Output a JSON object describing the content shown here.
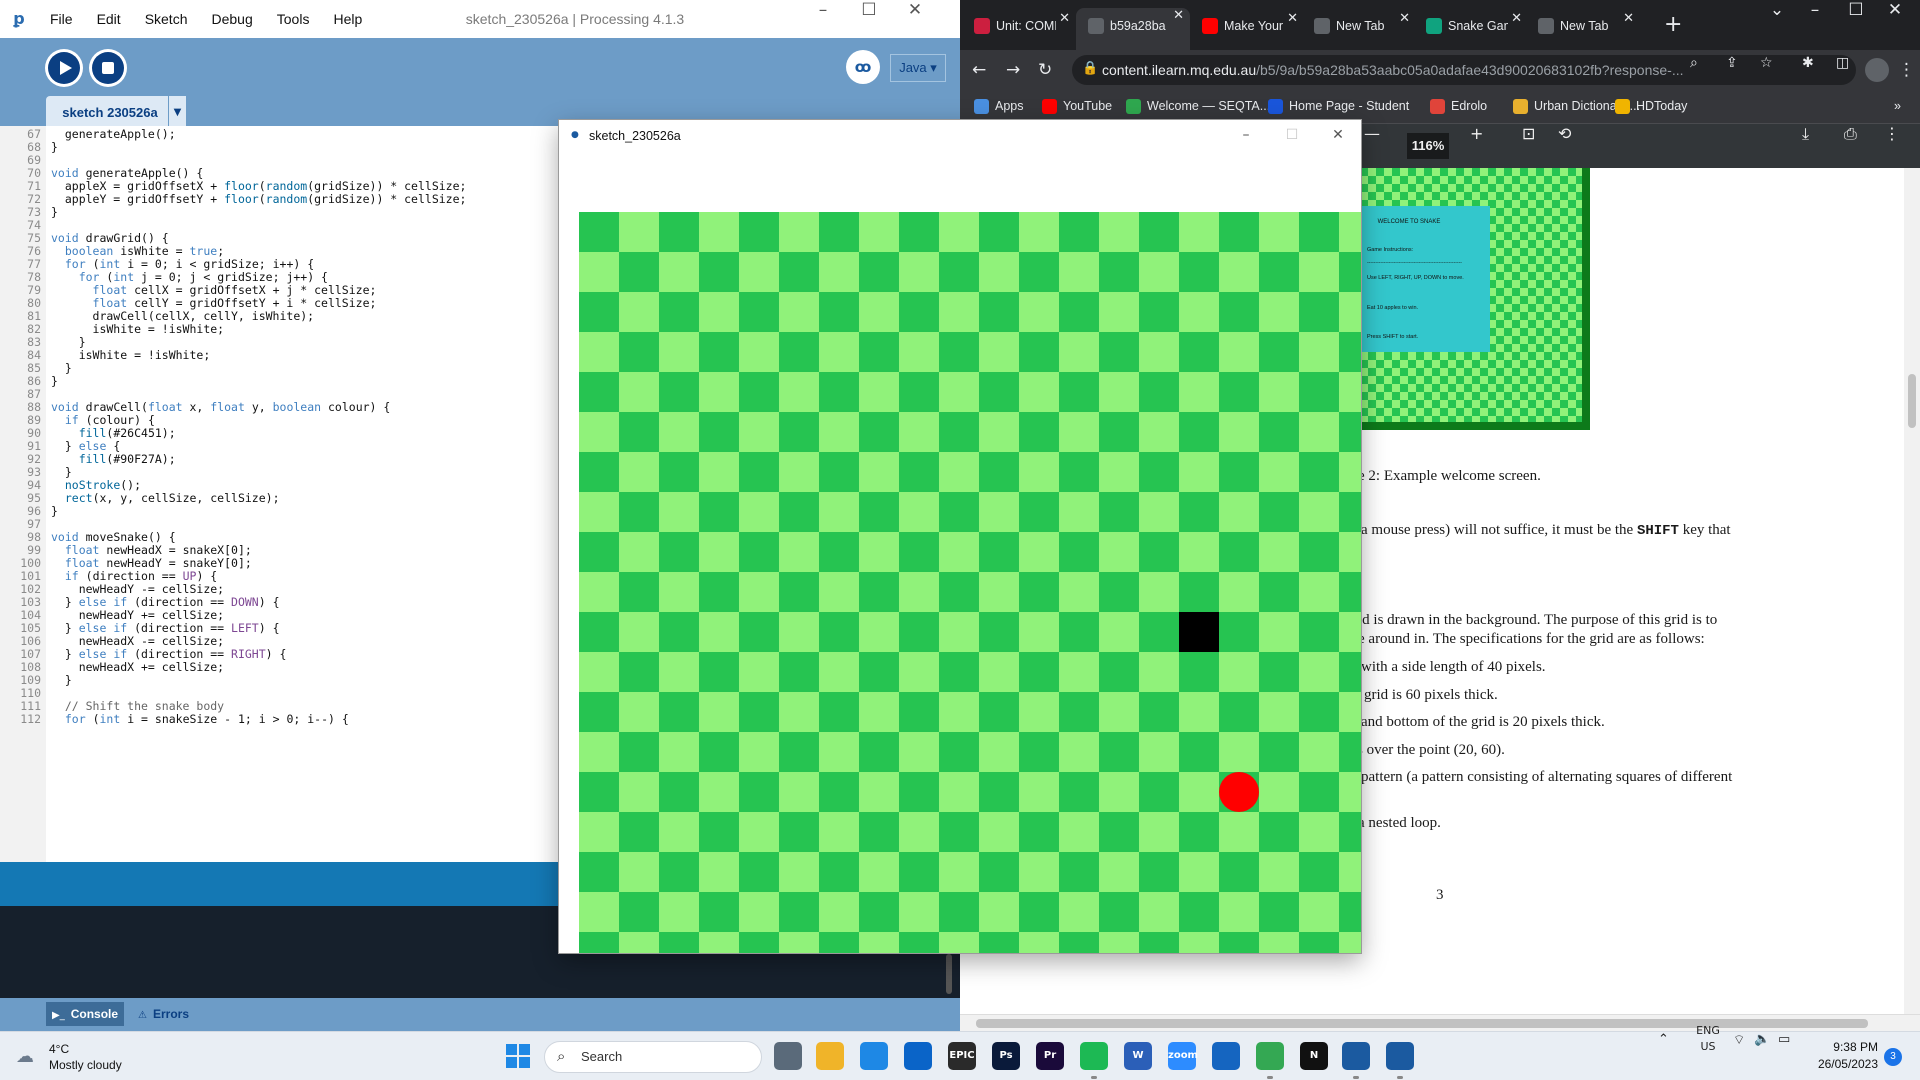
{
  "ide": {
    "menu": [
      "File",
      "Edit",
      "Sketch",
      "Debug",
      "Tools",
      "Help"
    ],
    "window_title": "sketch_230526a | Processing 4.1.3",
    "tab_label": "sketch 230526a",
    "mode": "Java ▾",
    "bottom_tabs": {
      "console": "Console",
      "errors": "Errors"
    },
    "code_lines": [
      {
        "n": "67",
        "html": "  generateApple();"
      },
      {
        "n": "68",
        "html": "}"
      },
      {
        "n": "69",
        "html": ""
      },
      {
        "n": "70",
        "html": "<span class=\"kw\">void</span> generateApple() {"
      },
      {
        "n": "71",
        "html": "  appleX = gridOffsetX + <span class=\"fn\">floor</span>(<span class=\"fn\">random</span>(gridSize)) * cellSize;"
      },
      {
        "n": "72",
        "html": "  appleY = gridOffsetY + <span class=\"fn\">floor</span>(<span class=\"fn\">random</span>(gridSize)) * cellSize;"
      },
      {
        "n": "73",
        "html": "}"
      },
      {
        "n": "74",
        "html": ""
      },
      {
        "n": "75",
        "html": "<span class=\"kw\">void</span> drawGrid() {"
      },
      {
        "n": "76",
        "html": "  <span class=\"kw\">boolean</span> isWhite = <span class=\"kw\">true</span>;"
      },
      {
        "n": "77",
        "html": "  <span class=\"kw\">for</span> (<span class=\"kw\">int</span> i = 0; i &lt; gridSize; i++) {"
      },
      {
        "n": "78",
        "html": "    <span class=\"kw\">for</span> (<span class=\"kw\">int</span> j = 0; j &lt; gridSize; j++) {"
      },
      {
        "n": "79",
        "html": "      <span class=\"kw\">float</span> cellX = gridOffsetX + j * cellSize;"
      },
      {
        "n": "80",
        "html": "      <span class=\"kw\">float</span> cellY = gridOffsetY + i * cellSize;"
      },
      {
        "n": "81",
        "html": "      drawCell(cellX, cellY, isWhite);"
      },
      {
        "n": "82",
        "html": "      isWhite = !isWhite;"
      },
      {
        "n": "83",
        "html": "    }"
      },
      {
        "n": "84",
        "html": "    isWhite = !isWhite;"
      },
      {
        "n": "85",
        "html": "  }"
      },
      {
        "n": "86",
        "html": "}"
      },
      {
        "n": "87",
        "html": ""
      },
      {
        "n": "88",
        "html": "<span class=\"kw\">void</span> drawCell(<span class=\"kw\">float</span> x, <span class=\"kw\">float</span> y, <span class=\"kw\">boolean</span> colour) {"
      },
      {
        "n": "89",
        "html": "  <span class=\"kw\">if</span> (colour) {"
      },
      {
        "n": "90",
        "html": "    <span class=\"fn\">fill</span>(#26C451);"
      },
      {
        "n": "91",
        "html": "  } <span class=\"kw\">else</span> {"
      },
      {
        "n": "92",
        "html": "    <span class=\"fn\">fill</span>(#90F27A);"
      },
      {
        "n": "93",
        "html": "  }"
      },
      {
        "n": "94",
        "html": "  <span class=\"fn\">noStroke</span>();"
      },
      {
        "n": "95",
        "html": "  <span class=\"fn\">rect</span>(x, y, cellSize, cellSize);"
      },
      {
        "n": "96",
        "html": "}"
      },
      {
        "n": "97",
        "html": ""
      },
      {
        "n": "98",
        "html": "<span class=\"kw\">void</span> moveSnake() {"
      },
      {
        "n": "99",
        "html": "  <span class=\"kw\">float</span> newHeadX = snakeX[0];"
      },
      {
        "n": "100",
        "html": "  <span class=\"kw\">float</span> newHeadY = snakeY[0];"
      },
      {
        "n": "101",
        "html": "  <span class=\"kw\">if</span> (direction == <span class=\"lit\">UP</span>) {"
      },
      {
        "n": "102",
        "html": "    newHeadY -= cellSize;"
      },
      {
        "n": "103",
        "html": "  } <span class=\"kw\">else if</span> (direction == <span class=\"lit\">DOWN</span>) {"
      },
      {
        "n": "104",
        "html": "    newHeadY += cellSize;"
      },
      {
        "n": "105",
        "html": "  } <span class=\"kw\">else if</span> (direction == <span class=\"lit\">LEFT</span>) {"
      },
      {
        "n": "106",
        "html": "    newHeadX -= cellSize;"
      },
      {
        "n": "107",
        "html": "  } <span class=\"kw\">else if</span> (direction == <span class=\"lit\">RIGHT</span>) {"
      },
      {
        "n": "108",
        "html": "    newHeadX += cellSize;"
      },
      {
        "n": "109",
        "html": "  }"
      },
      {
        "n": "110",
        "html": ""
      },
      {
        "n": "111",
        "html": "  <span class=\"cm\">// Shift the snake body</span>"
      },
      {
        "n": "112",
        "html": "  <span class=\"kw\">for</span> (<span class=\"kw\">int</span> i = snakeSize - 1; i &gt; 0; i--) {"
      }
    ]
  },
  "sketch": {
    "title": "sketch_230526a",
    "colors": {
      "dark": "#26C451",
      "light": "#90F27A",
      "snake": "#000000",
      "apple": "#FF0000"
    },
    "board": {
      "cols": 20,
      "rows": 19,
      "first_cell_dark": true
    },
    "snake_head_cell": {
      "col": 15,
      "row": 10
    },
    "apple_cell": {
      "col": 16,
      "row": 14
    }
  },
  "chrome": {
    "tabs": [
      {
        "label": "Unit: COMP",
        "icon": "unit-icon",
        "color": "#cc1f3f"
      },
      {
        "label": "b59a28ba",
        "icon": "pdf-icon",
        "color": "#5f6368"
      },
      {
        "label": "Make Your",
        "icon": "youtube-icon",
        "color": "#ff0000"
      },
      {
        "label": "New Tab",
        "icon": "chrome-icon",
        "color": "#5f6368"
      },
      {
        "label": "Snake Game",
        "icon": "chatgpt-icon",
        "color": "#10a37f"
      },
      {
        "label": "New Tab",
        "icon": "chrome-icon",
        "color": "#5f6368"
      }
    ],
    "url_host": "content.ilearn.mq.edu.au",
    "url_path": "/b5/9a/b59a28ba53aabc05a0adafae43d90020683102fb?response-...",
    "bookmarks": [
      {
        "label": "Apps",
        "icon": "apps-icon",
        "color": "#4a90e2"
      },
      {
        "label": "YouTube",
        "icon": "youtube-icon",
        "color": "#ff0000"
      },
      {
        "label": "Welcome — SEQTA...",
        "icon": "seqta-icon",
        "color": "#2fa84f"
      },
      {
        "label": "Home Page - Student",
        "icon": "student-icon",
        "color": "#1a56db"
      },
      {
        "label": "Edrolo",
        "icon": "edrolo-icon",
        "color": "#e0443a"
      },
      {
        "label": "Urban Dictionary,...",
        "icon": "urban-dictionary-icon",
        "color": "#e8b02e"
      },
      {
        "label": "HDToday",
        "icon": "hdtoday-icon",
        "color": "#f0b400"
      }
    ],
    "zoom": "116%",
    "pdf": {
      "welcome_box": {
        "title": "WELCOME TO SNAKE",
        "lines": [
          "Game Instructions:",
          "---------------------------------------------------------",
          "Use LEFT, RIGHT, UP, DOWN to move.",
          "Eat 10 apples to win.",
          "Press SHIFT to start."
        ]
      },
      "caption": "e 2: Example welcome screen.",
      "para1_pre": "a mouse press) will not suffice, it must be the ",
      "para1_key": "SHIFT",
      "para1_post": " key that",
      "para2_l1": "id is drawn in the background.  The purpose of this grid is to",
      "para2_l2": "e around in. The specifications for the grid are as follows:",
      "bullets": [
        "with a side length of 40 pixels.",
        "grid is 60 pixels thick.",
        "and bottom of the grid is 20 pixels thick.",
        "s over the point (20, 60).",
        "pattern (a pattern consisting of alternating squares of different"
      ],
      "nested": "a nested loop.",
      "page_number": "3"
    }
  },
  "taskbar": {
    "weather_temp": "4°C",
    "weather_desc": "Mostly cloudy",
    "search": "Search",
    "lang1": "ENG",
    "lang2": "US",
    "time": "9:38 PM",
    "date": "26/05/2023",
    "notifications": "3",
    "apps": [
      {
        "name": "task-view",
        "label": "",
        "color": "#5a6a7a"
      },
      {
        "name": "file-explorer",
        "label": "",
        "color": "#f0b429"
      },
      {
        "name": "microsoft-store",
        "label": "",
        "color": "#1e88e5"
      },
      {
        "name": "mail",
        "label": "",
        "color": "#0a64c8"
      },
      {
        "name": "epic-games",
        "label": "EPIC",
        "color": "#2a2a2a"
      },
      {
        "name": "photoshop",
        "label": "Ps",
        "color": "#0a1a3a"
      },
      {
        "name": "premiere-pro",
        "label": "Pr",
        "color": "#1a0a3a"
      },
      {
        "name": "spotify",
        "label": "",
        "color": "#1db954"
      },
      {
        "name": "word",
        "label": "W",
        "color": "#2b5fb8"
      },
      {
        "name": "zoom",
        "label": "zoom",
        "color": "#2d8cff"
      },
      {
        "name": "news-app",
        "label": "",
        "color": "#1565c0"
      },
      {
        "name": "chrome",
        "label": "",
        "color": "#34a853"
      },
      {
        "name": "notion",
        "label": "N",
        "color": "#111111"
      },
      {
        "name": "processing",
        "label": "",
        "color": "#1b5aa0"
      },
      {
        "name": "sketch-running",
        "label": "",
        "color": "#1b5aa0"
      }
    ]
  }
}
